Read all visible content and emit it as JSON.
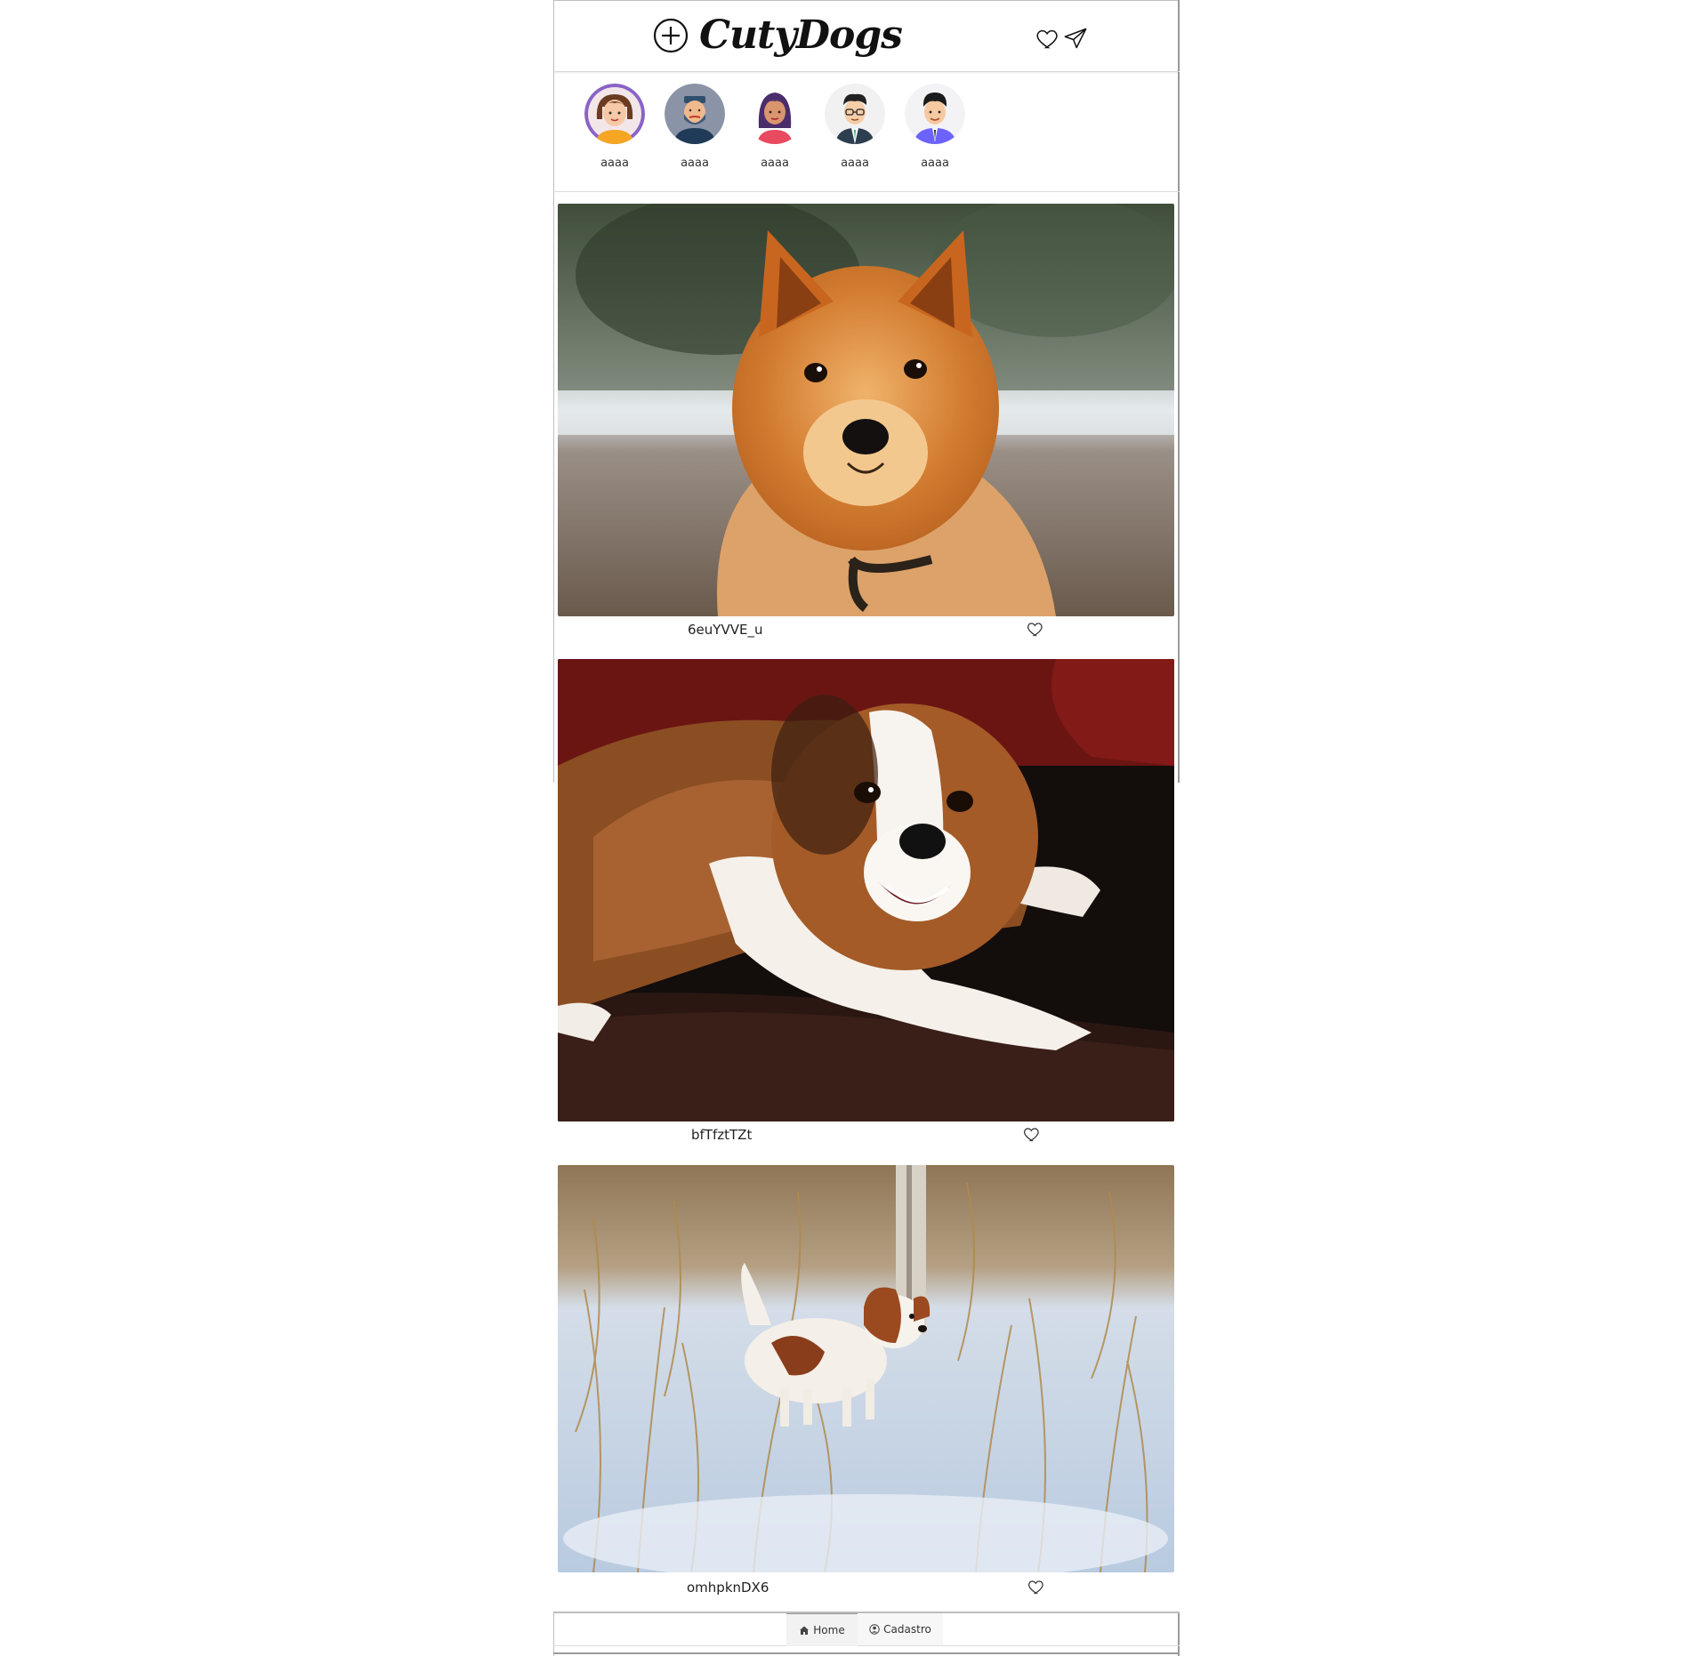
{
  "header": {
    "brand": "CutyDogs",
    "add_icon": "plus-circle-icon",
    "like_icon": "heart-outline-icon",
    "send_icon": "paper-plane-icon"
  },
  "stories": [
    {
      "name": "aaaa",
      "avatar": "woman-avatar-icon"
    },
    {
      "name": "aaaa",
      "avatar": "bearded-man-avatar-icon"
    },
    {
      "name": "aaaa",
      "avatar": "woman-avatar-icon"
    },
    {
      "name": "aaaa",
      "avatar": "man-glasses-avatar-icon"
    },
    {
      "name": "aaaa",
      "avatar": "man-avatar-icon"
    }
  ],
  "posts": [
    {
      "username": "6euYVVE_u",
      "image": "orange fluffy dog in snow"
    },
    {
      "username": "bfTfztTZt",
      "image": "brown and white dog on leather couch"
    },
    {
      "username": "omhpknDX6",
      "image": "small spaniel running in snow"
    }
  ],
  "bottom_nav": {
    "home_label": "Home",
    "cadastro_label": "Cadastro",
    "home_icon": "home-icon",
    "cadastro_icon": "user-circle-icon"
  },
  "colors": {
    "text": "#222222",
    "border": "#bfbfbf",
    "accent_avatar_purple": "#8a63c8"
  }
}
